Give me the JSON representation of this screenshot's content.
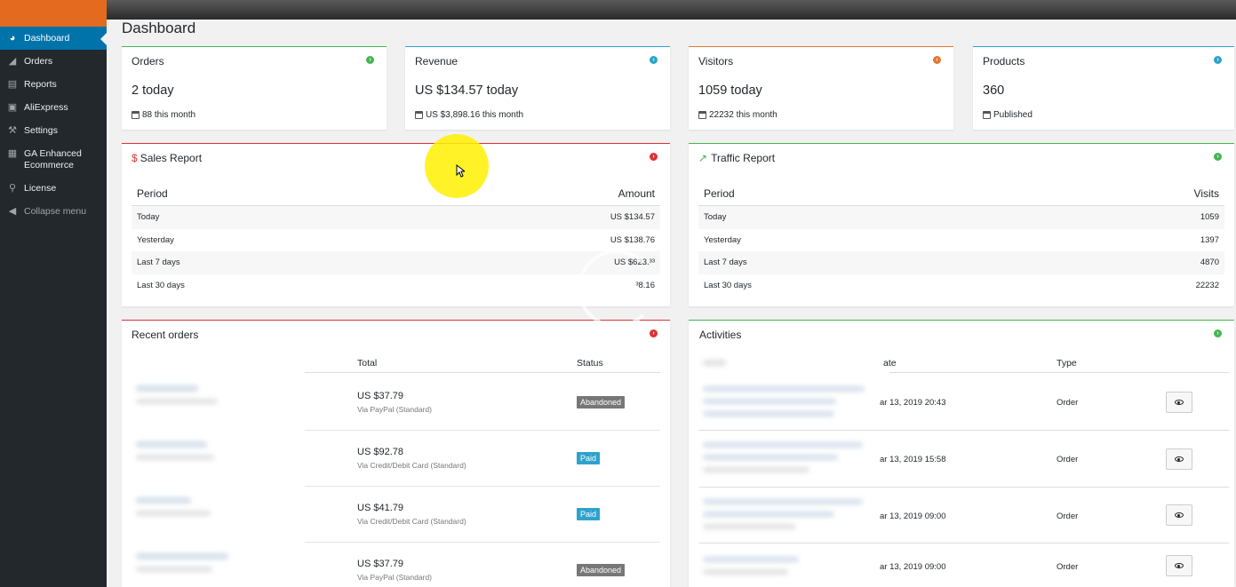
{
  "page": {
    "title": "Dashboard"
  },
  "sidebar": {
    "items": [
      {
        "label": "Dashboard",
        "icon": "dashboard-icon",
        "active": true
      },
      {
        "label": "Orders",
        "icon": "chart-area-icon"
      },
      {
        "label": "Reports",
        "icon": "bar-chart-icon"
      },
      {
        "label": "AliExpress",
        "icon": "shopping-bag-icon"
      },
      {
        "label": "Settings",
        "icon": "wrench-icon"
      },
      {
        "label": "GA Enhanced Ecommerce",
        "icon": "ga-icon"
      },
      {
        "label": "License",
        "icon": "key-icon"
      },
      {
        "label": "Collapse menu",
        "icon": "collapse-icon"
      }
    ]
  },
  "stats": {
    "orders": {
      "title": "Orders",
      "value": "2 today",
      "sub": "88 this month",
      "accent": "#46b450"
    },
    "revenue": {
      "title": "Revenue",
      "value": "US $134.57 today",
      "sub": "US $3,898.16 this month",
      "accent": "#2ea2cc"
    },
    "visitors": {
      "title": "Visitors",
      "value": "1059 today",
      "sub": "22232 this month",
      "accent": "#e27730"
    },
    "products": {
      "title": "Products",
      "value": "360",
      "sub": "Published",
      "accent": "#2ea2cc"
    }
  },
  "sales_report": {
    "title": "Sales Report",
    "header": {
      "period": "Period",
      "amount": "Amount"
    },
    "rows": [
      {
        "period": "Today",
        "amount": "US $134.57"
      },
      {
        "period": "Yesterday",
        "amount": "US $138.76"
      },
      {
        "period": "Last 7 days",
        "amount": "US $623.³³"
      },
      {
        "period": "Last 30 days",
        "amount": "³8.16"
      }
    ]
  },
  "traffic_report": {
    "title": "Traffic Report",
    "header": {
      "period": "Period",
      "visits": "Visits"
    },
    "rows": [
      {
        "period": "Today",
        "visits": "1059"
      },
      {
        "period": "Yesterday",
        "visits": "1397"
      },
      {
        "period": "Last 7 days",
        "visits": "4870"
      },
      {
        "period": "Last 30 days",
        "visits": "22232"
      }
    ]
  },
  "recent_orders": {
    "title": "Recent orders",
    "columns": {
      "total": "Total",
      "status": "Status"
    },
    "rows": [
      {
        "amount": "US $37.79",
        "via": "Via PayPal (Standard)",
        "status": "Abandoned"
      },
      {
        "amount": "US $92.78",
        "via": "Via Credit/Debit Card (Standard)",
        "status": "Paid"
      },
      {
        "amount": "US $41.79",
        "via": "Via Credit/Debit Card (Standard)",
        "status": "Paid"
      },
      {
        "amount": "US $37.79",
        "via": "Via PayPal (Standard)",
        "status": "Abandoned"
      }
    ]
  },
  "activities": {
    "title": "Activities",
    "columns": {
      "date": "ate",
      "type": "Type"
    },
    "rows": [
      {
        "date": "ar 13, 2019 20:43",
        "type": "Order"
      },
      {
        "date": "ar 13, 2019 15:58",
        "type": "Order"
      },
      {
        "date": "ar 13, 2019 09:00",
        "type": "Order"
      },
      {
        "date": "ar 13, 2019 09:00",
        "type": "Order"
      }
    ]
  }
}
